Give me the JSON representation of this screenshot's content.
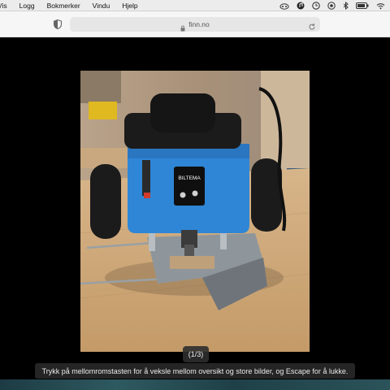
{
  "menubar": {
    "items": [
      "Vis",
      "Logg",
      "Bokmerker",
      "Vindu",
      "Hjelp"
    ],
    "tray_icons": [
      "cloud-icon",
      "music-note-icon",
      "clock-icon",
      "record-icon",
      "bluetooth-icon",
      "battery-icon",
      "wifi-icon"
    ]
  },
  "toolbar": {
    "url": "finn.no",
    "icons": [
      "privacy-shield-icon",
      "lock-icon",
      "reload-icon"
    ]
  },
  "viewer": {
    "counter": "(1/3)",
    "hint": "Trykk på mellomromstasten for å veksle mellom oversikt og store bilder, og Escape for å lukke.",
    "photo_label": "BILTEMA",
    "colors": {
      "tool_blue": "#2f86d6",
      "tool_black": "#1b1b1b",
      "wood": "#c9a273"
    }
  }
}
